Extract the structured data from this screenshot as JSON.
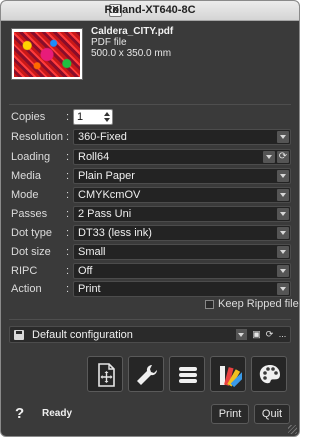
{
  "window": {
    "title": "Roland-XT640-8C"
  },
  "file": {
    "name": "Caldera_CITY.pdf",
    "type": "PDF file",
    "size": "500.0 x 350.0 mm"
  },
  "settings": {
    "copies": {
      "label": "Copies",
      "value": "1"
    },
    "resolution": {
      "label": "Resolution",
      "value": "360-Fixed"
    },
    "loading": {
      "label": "Loading",
      "value": "Roll64"
    },
    "media": {
      "label": "Media",
      "value": "Plain Paper"
    },
    "mode": {
      "label": "Mode",
      "value": "CMYKcmOV"
    },
    "passes": {
      "label": "Passes",
      "value": "2 Pass Uni"
    },
    "dot_type": {
      "label": "Dot type",
      "value": "DT33 (less ink)"
    },
    "dot_size": {
      "label": "Dot size",
      "value": "Small"
    },
    "ripc": {
      "label": "RIPC",
      "value": "Off"
    },
    "action": {
      "label": "Action",
      "value": "Print"
    }
  },
  "colon": ":",
  "keep_ripped": {
    "label": "Keep Ripped file",
    "checked": false
  },
  "config": {
    "value": "Default configuration",
    "more_label": "..."
  },
  "toolbar": {
    "icons": [
      "add-page-icon",
      "wrench-icon",
      "stack-icon",
      "swatch-fan-icon",
      "palette-icon"
    ]
  },
  "footer": {
    "help": "?",
    "status": "Ready",
    "print_label": "Print",
    "quit_label": "Quit"
  }
}
